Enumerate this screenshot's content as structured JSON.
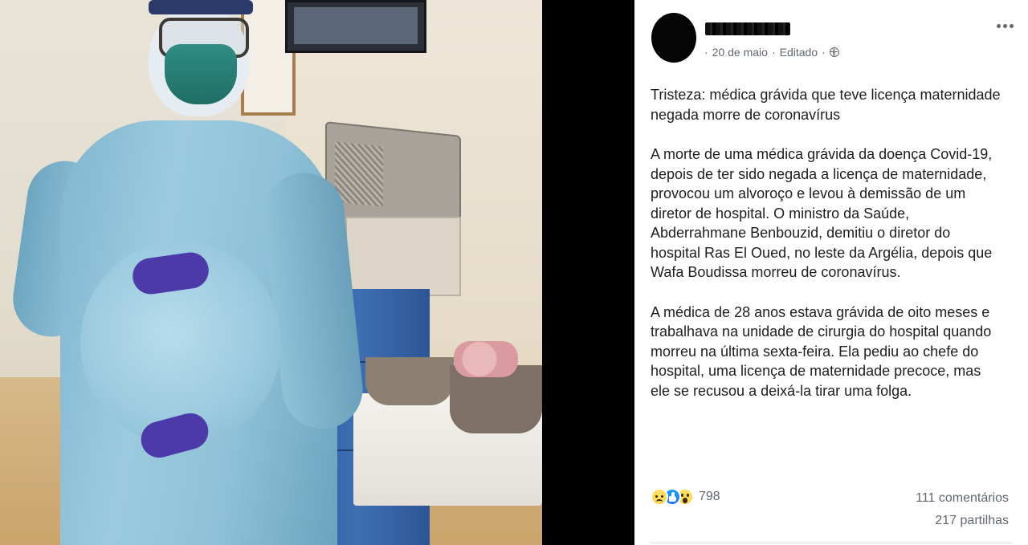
{
  "post": {
    "author_name": "",
    "date": "20 de maio",
    "separator": "·",
    "edited_label": "Editado",
    "paragraphs": [
      "Tristeza: médica grávida que teve licença maternidade negada morre de coronavírus",
      "A morte de uma médica grávida da doença Covid-19, depois de ter sido negada a licença de maternidade, provocou um alvoroço e levou à demissão de um diretor de hospital. O ministro da Saúde, Abderrahmane Benbouzid, demitiu o diretor do hospital Ras El Oued, no leste da Argélia, depois que Wafa Boudissa morreu de coronavírus.",
      "A médica de 28 anos estava grávida de oito meses e trabalhava na unidade de cirurgia do hospital quando morreu na última sexta-feira. Ela pediu ao chefe do hospital, uma licença de maternidade precoce, mas ele se recusou a deixá-la tirar uma folga."
    ],
    "reactions": {
      "icons": [
        "sad-icon",
        "like-icon",
        "wow-icon"
      ],
      "count": "798"
    },
    "comments_label": "111 comentários",
    "shares_label": "217 partilhas"
  },
  "colors": {
    "link": "#385898",
    "meta_text": "#606770",
    "body_text": "#1c1e21",
    "like_blue": "#1877f2"
  }
}
